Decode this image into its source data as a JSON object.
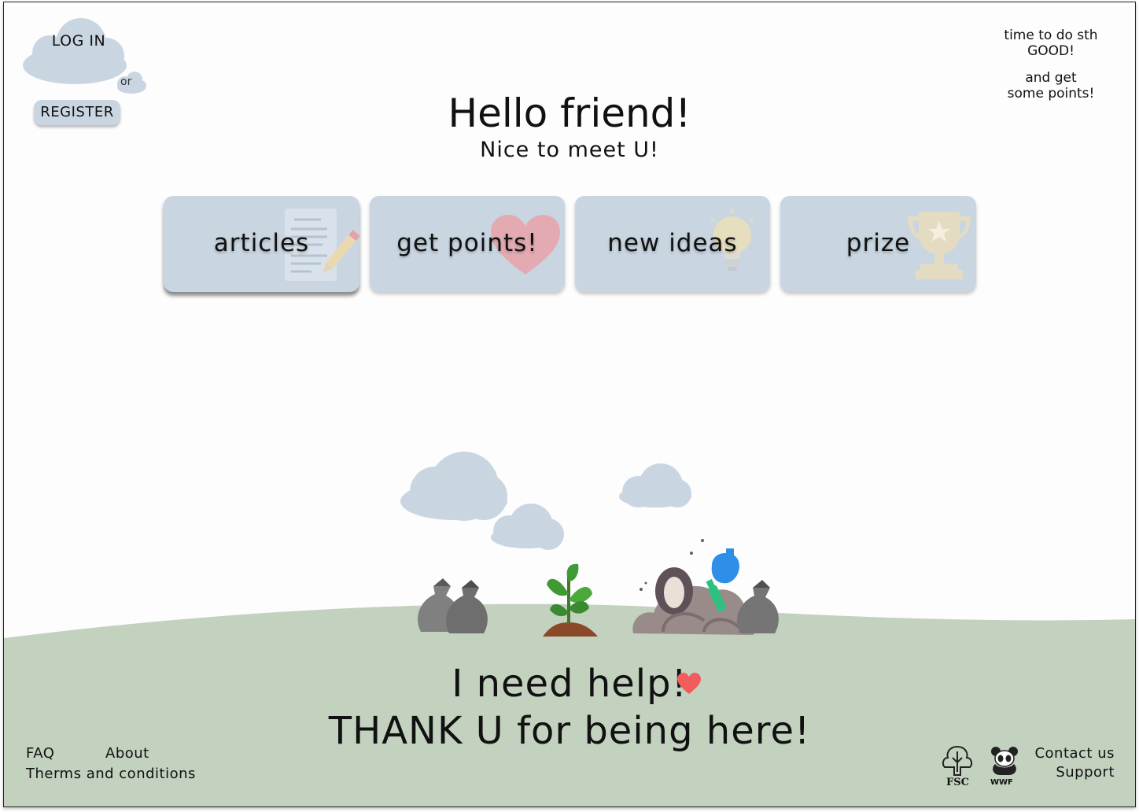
{
  "auth": {
    "login_label": "LOG IN",
    "or_label": "or",
    "register_label": "REGISTER"
  },
  "note": {
    "line1": "time to do sth",
    "line2": "GOOD!",
    "line3": "and get",
    "line4": "some points!"
  },
  "hero": {
    "title": "Hello friend!",
    "subtitle": "Nice to meet U!"
  },
  "nav": {
    "cards": [
      {
        "label": "articles",
        "icon": "document-pencil-icon"
      },
      {
        "label": "get points!",
        "icon": "heart-icon"
      },
      {
        "label": "new ideas",
        "icon": "lightbulb-icon"
      },
      {
        "label": "prize",
        "icon": "trophy-icon"
      }
    ]
  },
  "message": {
    "line1": "I need help!",
    "line2": "THANK U for being here!"
  },
  "footer": {
    "faq": "FAQ",
    "about": "About",
    "terms": "Therms and conditions",
    "contact": "Contact us",
    "support": "Support",
    "fsc": "FSC",
    "wwf": "WWF"
  },
  "colors": {
    "cloud": "#c9d6e1",
    "ground": "#c3d1bf",
    "heart": "#f25c5c",
    "icon_heart": "#e8a3a8",
    "icon_bulb": "#eadfb8",
    "icon_trophy": "#e6ddbf"
  }
}
